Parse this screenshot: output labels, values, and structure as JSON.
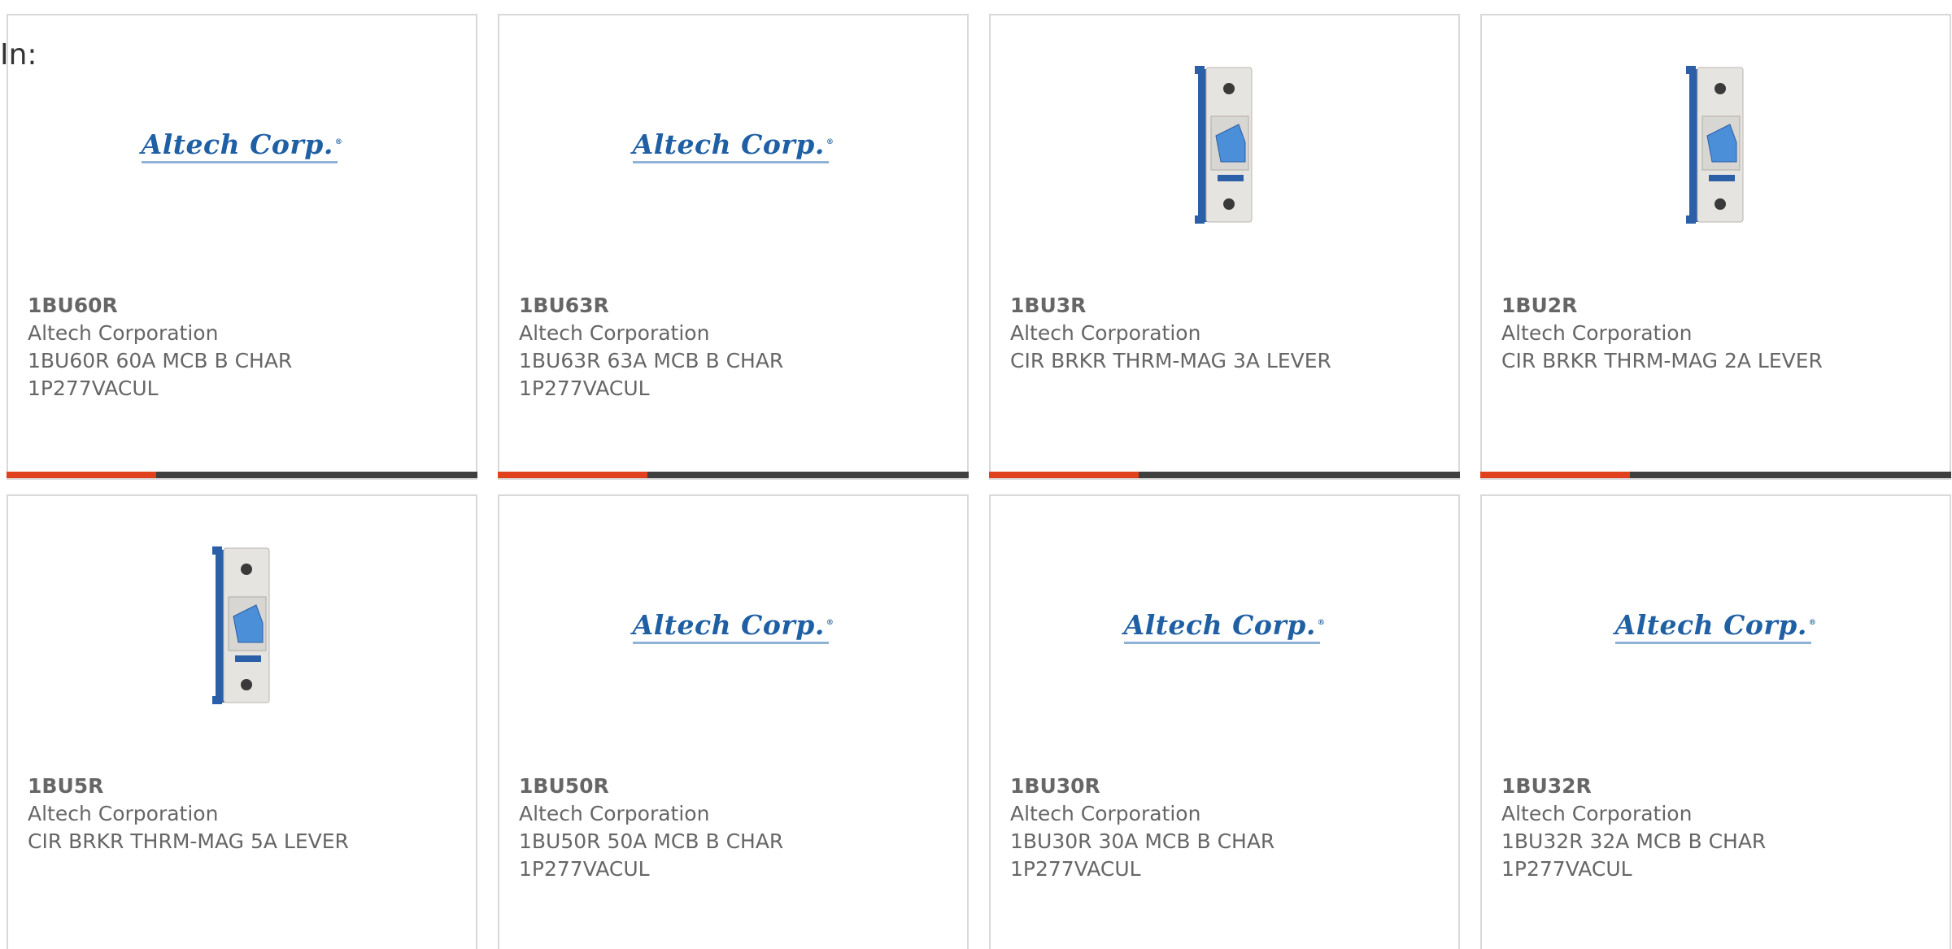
{
  "filter": {
    "label": "In:"
  },
  "colors": {
    "accent": "#e0401c",
    "bar": "#3f3f3f",
    "logo": "#1f5fa3",
    "text": "#666666"
  },
  "logo_text": "Altech Corp.",
  "products": [
    {
      "part": "1BU60R",
      "manufacturer": "Altech Corporation",
      "desc_1": "1BU60R 60A MCB B CHAR",
      "desc_2": "1P277VACUL",
      "image": "altech-logo"
    },
    {
      "part": "1BU63R",
      "manufacturer": "Altech Corporation",
      "desc_1": "1BU63R 63A MCB B CHAR",
      "desc_2": "1P277VACUL",
      "image": "altech-logo"
    },
    {
      "part": "1BU3R",
      "manufacturer": "Altech Corporation",
      "desc_1": "CIR BRKR THRM-MAG 3A LEVER",
      "desc_2": "",
      "image": "circuit-breaker"
    },
    {
      "part": "1BU2R",
      "manufacturer": "Altech Corporation",
      "desc_1": "CIR BRKR THRM-MAG 2A LEVER",
      "desc_2": "",
      "image": "circuit-breaker"
    },
    {
      "part": "1BU5R",
      "manufacturer": "Altech Corporation",
      "desc_1": "CIR BRKR THRM-MAG 5A LEVER",
      "desc_2": "",
      "image": "circuit-breaker"
    },
    {
      "part": "1BU50R",
      "manufacturer": "Altech Corporation",
      "desc_1": "1BU50R 50A MCB B CHAR",
      "desc_2": "1P277VACUL",
      "image": "altech-logo"
    },
    {
      "part": "1BU30R",
      "manufacturer": "Altech Corporation",
      "desc_1": "1BU30R 30A MCB B CHAR",
      "desc_2": "1P277VACUL",
      "image": "altech-logo"
    },
    {
      "part": "1BU32R",
      "manufacturer": "Altech Corporation",
      "desc_1": "1BU32R 32A MCB B CHAR",
      "desc_2": "1P277VACUL",
      "image": "altech-logo"
    }
  ]
}
